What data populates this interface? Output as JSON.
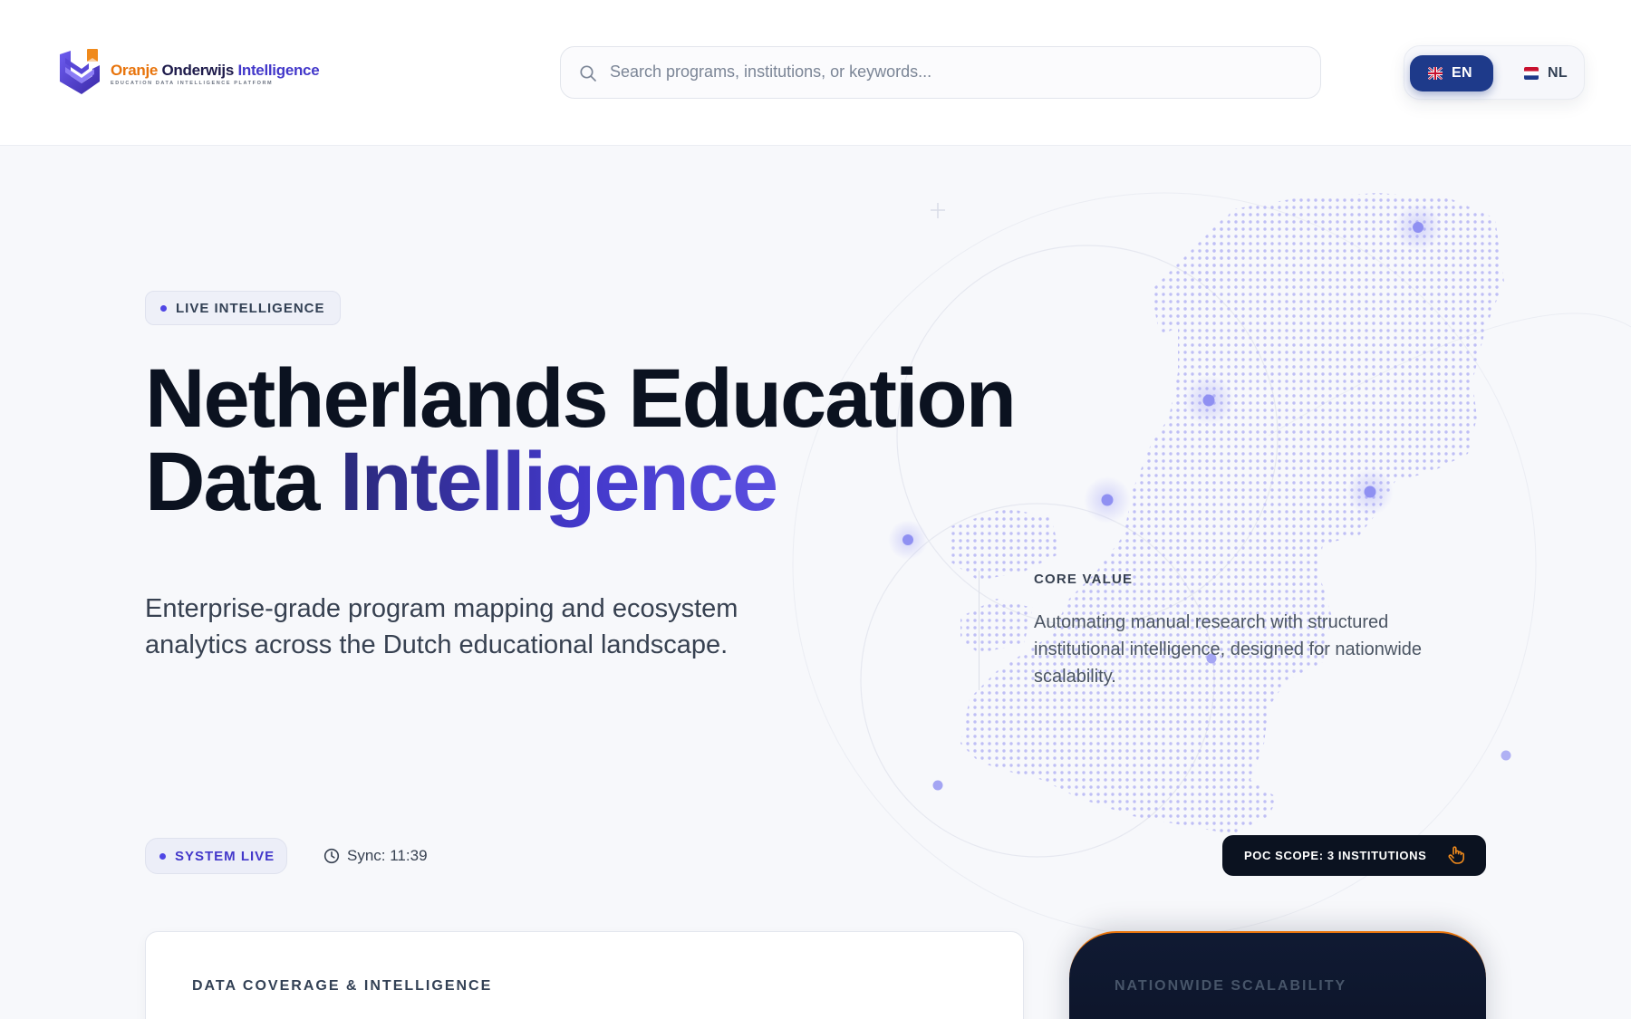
{
  "header": {
    "logo": {
      "name_part1": "Oranje",
      "name_part2": "Onderwijs",
      "name_part3": "Intelligence",
      "tagline": "EDUCATION DATA INTELLIGENCE PLATFORM"
    },
    "search": {
      "placeholder": "Search programs, institutions, or keywords...",
      "value": ""
    },
    "language": {
      "options": [
        {
          "code": "EN",
          "selected": true
        },
        {
          "code": "NL",
          "selected": false
        }
      ]
    }
  },
  "hero": {
    "badge": "LIVE INTELLIGENCE",
    "title_line1": "Netherlands Education",
    "title_line2_plain": "Data",
    "title_line2_accent": "Intelligence",
    "subtitle": "Enterprise-grade program mapping and ecosystem analytics across the Dutch educational landscape.",
    "core_value": {
      "label": "CORE VALUE",
      "text": "Automating manual research with structured institutional intelligence, designed for nationwide scalability."
    }
  },
  "status": {
    "system_badge": "SYSTEM LIVE",
    "sync": "Sync: 11:39",
    "poc_button": "POC SCOPE: 3 INSTITUTIONS"
  },
  "cards": {
    "coverage_title": "DATA COVERAGE & INTELLIGENCE",
    "scalability_title": "NATIONWIDE SCALABILITY"
  },
  "icons": {
    "search": "search-icon",
    "clock": "clock-icon",
    "pointer": "hand-pointer-icon",
    "flag_en": "uk-flag-icon",
    "flag_nl": "netherlands-flag-icon",
    "logo": "shield-logo-icon"
  },
  "colors": {
    "brand_orange": "#e8740c",
    "brand_indigo": "#4338ca",
    "navy": "#1e3a8a",
    "dark": "#0b1220"
  }
}
